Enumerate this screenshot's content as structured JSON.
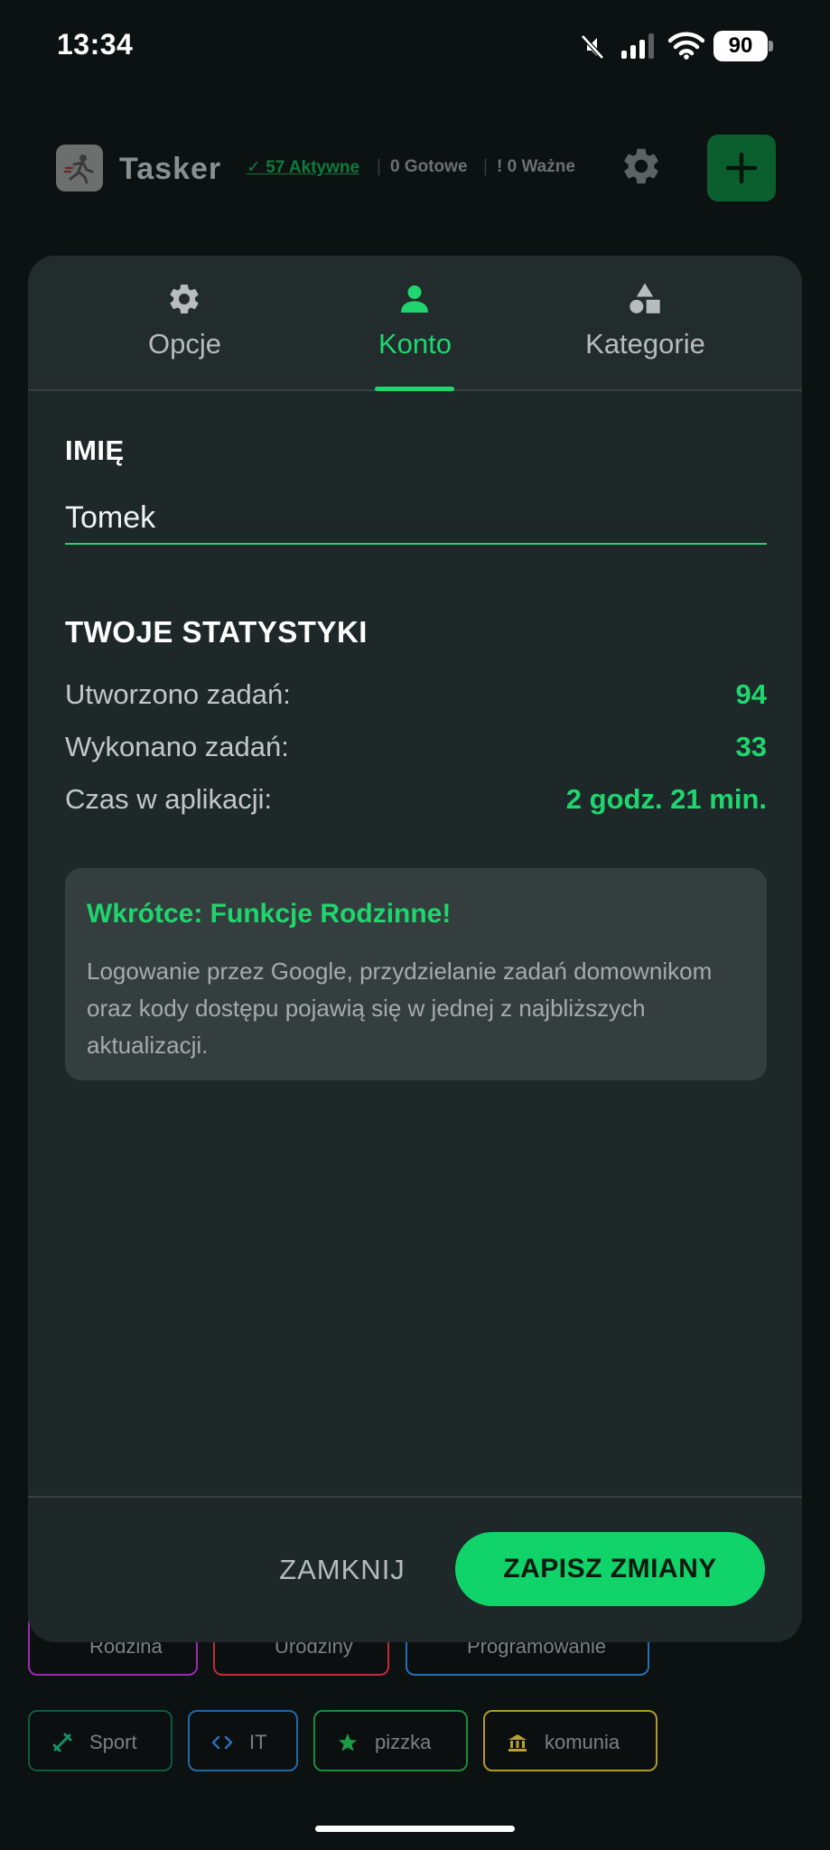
{
  "status_bar": {
    "time": "13:34",
    "battery": "90",
    "icons": [
      "mute-icon",
      "signal-icon",
      "wifi-icon",
      "battery-icon"
    ]
  },
  "app_header": {
    "title": "Tasker",
    "active": "✓ 57 Aktywne",
    "done": "0 Gotowe",
    "important": "! 0 Ważne",
    "separator": "|",
    "icons": [
      "app-logo-icon",
      "gear-icon",
      "plus-icon"
    ]
  },
  "background_chips": [
    {
      "label": "Rodzina",
      "color": "#9c2bb0",
      "icon": "family-icon"
    },
    {
      "label": "Urodziny",
      "color": "#c42a3c",
      "icon": "gift-icon"
    },
    {
      "label": "Programowanie",
      "color": "#2b6fb0",
      "icon": "code-icon"
    },
    {
      "label": "Sport",
      "color": "#0f5a3c",
      "icon": "dumbbell-icon"
    },
    {
      "label": "IT",
      "color": "#2467a4",
      "icon": "code-icon"
    },
    {
      "label": "pizzka",
      "color": "#1d8a3e",
      "icon": "star-icon"
    },
    {
      "label": "komunia",
      "color": "#b09a2a",
      "icon": "bank-icon"
    }
  ],
  "modal": {
    "tabs": [
      {
        "label": "Opcje",
        "icon": "gear-icon",
        "active": false
      },
      {
        "label": "Konto",
        "icon": "person-icon",
        "active": true
      },
      {
        "label": "Kategorie",
        "icon": "shapes-icon",
        "active": false
      }
    ],
    "name_label": "IMIĘ",
    "name_value": "Tomek",
    "stats_title": "TWOJE STATYSTYKI",
    "stats": [
      {
        "label": "Utworzono zadań:",
        "value": "94"
      },
      {
        "label": "Wykonano zadań:",
        "value": "33"
      },
      {
        "label": "Czas w aplikacji:",
        "value": "2 godz. 21 min."
      }
    ],
    "notice": {
      "title": "Wkrótce: Funkcje Rodzinne!",
      "text": "Logowanie przez Google, przydzielanie zadań domownikom oraz kody dostępu pojawią się w jednej z najbliższych aktualizacji."
    },
    "buttons": {
      "close": "ZAMKNIJ",
      "save": "ZAPISZ ZMIANY"
    },
    "colors": {
      "accent": "#1fd66e",
      "surface": "#1f2829",
      "notice_bg": "#353e3f"
    }
  }
}
